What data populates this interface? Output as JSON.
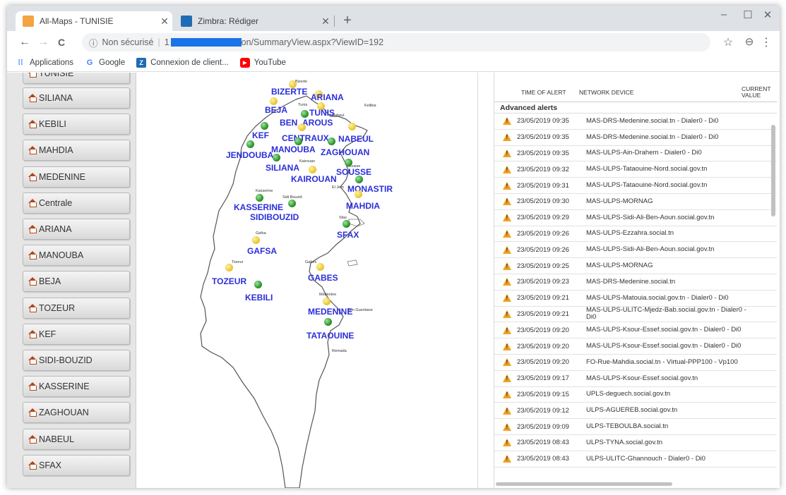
{
  "browser": {
    "tabs": [
      {
        "title": "All-Maps - TUNISIE",
        "favicon_color": "#f4a442",
        "active": true
      },
      {
        "title": "Zimbra: Rédiger",
        "favicon_color": "#1f6bb5",
        "active": false
      }
    ],
    "new_tab": "+",
    "window_controls": {
      "minimize": "–",
      "maximize": "☐",
      "close": "✕"
    },
    "nav": {
      "back": "←",
      "forward": "→",
      "reload": "C"
    },
    "address": {
      "security_label": "Non sécurisé",
      "prefix": "1",
      "url_suffix": "on/SummaryView.aspx?ViewID=192"
    },
    "toolbar_icons": {
      "star": "☆",
      "profile": "⊖",
      "menu": "⋮"
    },
    "bookmarks": [
      {
        "label": "Applications",
        "icon": "apps-icon",
        "color": "#4285f4"
      },
      {
        "label": "Google",
        "icon": "google-icon",
        "color": "#4285f4"
      },
      {
        "label": "Connexion de client...",
        "icon": "zimbra-icon",
        "color": "#1f6bb5"
      },
      {
        "label": "YouTube",
        "icon": "youtube-icon",
        "color": "#ff0000"
      }
    ]
  },
  "sidebar": {
    "top_partial": "TUNISIE",
    "regions": [
      "SILIANA",
      "KEBILI",
      "MAHDIA",
      "MEDENINE",
      "Centrale",
      "ARIANA",
      "MANOUBA",
      "BEJA",
      "TOZEUR",
      "KEF",
      "SIDI-BOUZID",
      "KASSERINE",
      "ZAGHOUAN",
      "NABEUL",
      "SFAX"
    ]
  },
  "map": {
    "cities": [
      {
        "name": "BIZERTE",
        "status": "yellow"
      },
      {
        "name": "ARIANA",
        "status": "yellow"
      },
      {
        "name": "BEJA",
        "status": "yellow"
      },
      {
        "name": "TUNIS",
        "status": "yellow"
      },
      {
        "name": "BEN_AROUS",
        "status": "green"
      },
      {
        "name": "KEF",
        "status": "green"
      },
      {
        "name": "CENTRAUX",
        "status": "yellow"
      },
      {
        "name": "NABEUL",
        "status": "yellow"
      },
      {
        "name": "JENDOUBA",
        "status": "green"
      },
      {
        "name": "MANOUBA",
        "status": "green"
      },
      {
        "name": "ZAGHOUAN",
        "status": "green"
      },
      {
        "name": "SILIANA",
        "status": "green"
      },
      {
        "name": "SOUSSE",
        "status": "green"
      },
      {
        "name": "KAIROUAN",
        "status": "yellow"
      },
      {
        "name": "MONASTIR",
        "status": "green"
      },
      {
        "name": "KASSERINE",
        "status": "green"
      },
      {
        "name": "MAHDIA",
        "status": "yellow"
      },
      {
        "name": "SIDIBOUZID",
        "status": "green"
      },
      {
        "name": "SFAX",
        "status": "green"
      },
      {
        "name": "GAFSA",
        "status": "yellow"
      },
      {
        "name": "TOZEUR",
        "status": "yellow"
      },
      {
        "name": "GABES",
        "status": "yellow"
      },
      {
        "name": "KEBILI",
        "status": "green"
      },
      {
        "name": "MEDENINE",
        "status": "yellow"
      },
      {
        "name": "TATAOUINE",
        "status": "green"
      }
    ],
    "small_labels": [
      "Bizerte",
      "Tunis",
      "Nabeul",
      "Kelibia",
      "Kasserine",
      "Sidi Bouzid",
      "Kairouan",
      "Sousse",
      "El Jem",
      "Sfax",
      "Gafsa",
      "Tozeur",
      "Gabes",
      "Médenine",
      "Ben Guerdane",
      "Remada"
    ]
  },
  "alerts": {
    "headers": {
      "time": "TIME OF ALERT",
      "device": "NETWORK DEVICE",
      "value": "CURRENT VALUE"
    },
    "group": "Advanced alerts",
    "rows": [
      {
        "time": "23/05/2019 09:35",
        "device": "MAS-DRS-Medenine.social.tn - Dialer0 - Di0"
      },
      {
        "time": "23/05/2019 09:35",
        "device": "MAS-DRS-Medenine.social.tn - Dialer0 - Di0"
      },
      {
        "time": "23/05/2019 09:35",
        "device": "MAS-ULPS-Ain-Drahem - Dialer0 - Di0"
      },
      {
        "time": "23/05/2019 09:32",
        "device": "MAS-ULPS-Tataouine-Nord.social.gov.tn"
      },
      {
        "time": "23/05/2019 09:31",
        "device": "MAS-ULPS-Tataouine-Nord.social.gov.tn"
      },
      {
        "time": "23/05/2019 09:30",
        "device": "MAS-ULPS-MORNAG"
      },
      {
        "time": "23/05/2019 09:29",
        "device": "MAS-ULPS-Sidi-Ali-Ben-Aoun.social.gov.tn"
      },
      {
        "time": "23/05/2019 09:26",
        "device": "MAS-ULPS-Ezzahra.social.tn"
      },
      {
        "time": "23/05/2019 09:26",
        "device": "MAS-ULPS-Sidi-Ali-Ben-Aoun.social.gov.tn"
      },
      {
        "time": "23/05/2019 09:25",
        "device": "MAS-ULPS-MORNAG"
      },
      {
        "time": "23/05/2019 09:23",
        "device": "MAS-DRS-Medenine.social.tn"
      },
      {
        "time": "23/05/2019 09:21",
        "device": "MAS-ULPS-Matouia.social.gov.tn - Dialer0 - Di0"
      },
      {
        "time": "23/05/2019 09:21",
        "device": "MAS-ULPS-ULITC-Mjedz-Bab.social.gov.tn - Dialer0 - Di0"
      },
      {
        "time": "23/05/2019 09:20",
        "device": "MAS-ULPS-Ksour-Essef.social.gov.tn - Dialer0 - Di0"
      },
      {
        "time": "23/05/2019 09:20",
        "device": "MAS-ULPS-Ksour-Essef.social.gov.tn - Dialer0 - Di0"
      },
      {
        "time": "23/05/2019 09:20",
        "device": "FO-Rue-Mahdia.social.tn - Virtual-PPP100 - Vp100"
      },
      {
        "time": "23/05/2019 09:17",
        "device": "MAS-ULPS-Ksour-Essef.social.gov.tn"
      },
      {
        "time": "23/05/2019 09:15",
        "device": "UPLS-deguech.social.gov.tn"
      },
      {
        "time": "23/05/2019 09:12",
        "device": "ULPS-AGUEREB.social.gov.tn"
      },
      {
        "time": "23/05/2019 09:09",
        "device": "ULPS-TEBOULBA.social.tn"
      },
      {
        "time": "23/05/2019 08:43",
        "device": "ULPS-TYNA.social.gov.tn"
      },
      {
        "time": "23/05/2019 08:43",
        "device": "ULPS-ULITC-Ghannouch - Dialer0 - Di0"
      }
    ]
  }
}
